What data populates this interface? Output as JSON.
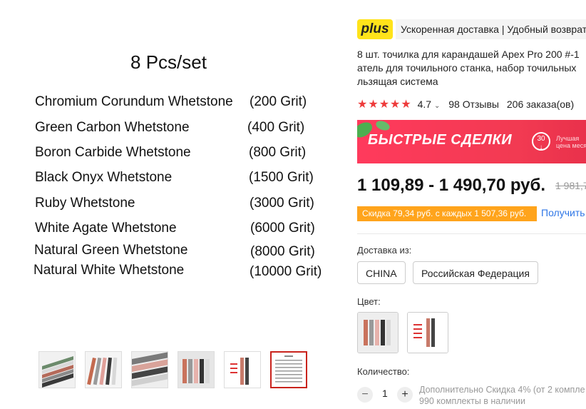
{
  "gallery": {
    "main_image": {
      "title": "8 Pcs/set",
      "rows": [
        {
          "name": "Chromium Corundum Whetstone",
          "grit": "(200 Grit)"
        },
        {
          "name": "Green Carbon Whetstone",
          "grit": "(400 Grit)"
        },
        {
          "name": "Boron Carbide Whetstone",
          "grit": "(800 Grit)"
        },
        {
          "name": "Black Onyx Whetstone",
          "grit": "(1500 Grit)"
        },
        {
          "name": "Ruby Whetstone",
          "grit": "(3000 Grit)"
        },
        {
          "name": "White Agate Whetstone",
          "grit": "(6000 Grit)"
        },
        {
          "name": "Natural Green Whetstone",
          "grit": "(8000 Grit)"
        },
        {
          "name": "Natural White Whetstone",
          "grit": "(10000 Grit)"
        }
      ]
    },
    "selected_thumbnail": 6
  },
  "header": {
    "plus_badge": "plus",
    "promo_text": "Ускоренная доставка | Удобный возврат"
  },
  "product": {
    "title_lines": [
      "8 шт. точилка для карандашей Apex Pro 200 #-1",
      "атель для точильного станка, набор точильных",
      "льзящая система"
    ],
    "rating": "4.7",
    "reviews": "98 Отзывы",
    "orders": "206 заказа(ов)",
    "deals_banner": "БЫСТРЫЕ СДЕЛКИ",
    "deals_badge_number": "30",
    "deals_badge_text_1": "Лучшая",
    "deals_badge_text_2": "цена месяц",
    "price_range": "1 109,89 - 1 490,70 руб.",
    "old_price": "1 981,7",
    "discount": "Скидка 79,34 руб. с каждых 1 507,36 руб.",
    "get_coupon": "Получить"
  },
  "shipping": {
    "label": "Доставка из:",
    "options": [
      "CHINA",
      "Российская Федерация"
    ]
  },
  "color": {
    "label": "Цвет:"
  },
  "quantity": {
    "label": "Количество:",
    "minus": "−",
    "value": "1",
    "plus": "+",
    "note_line1": "Дополнительно Скидка 4% (от 2 компле",
    "note_line2": "990 комплекты в наличии"
  },
  "colors": {
    "accent_red": "#ee3b3b",
    "plus_yellow": "#ffe31a",
    "discount_orange": "#ffa41c",
    "link_blue": "#2e76e6"
  }
}
